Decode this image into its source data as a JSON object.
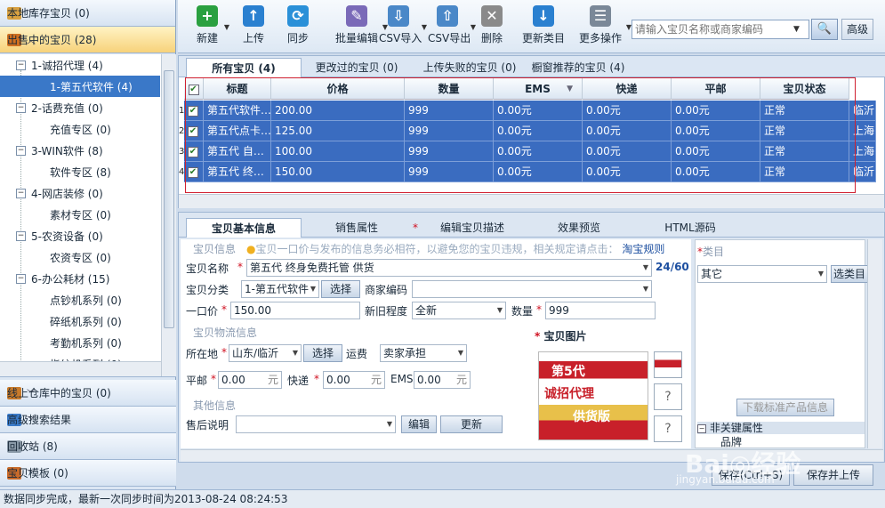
{
  "sidebar": {
    "top": {
      "label": "本地库存宝贝",
      "count": "(0)",
      "color": "#d8a040"
    },
    "selling": {
      "label": "出售中的宝贝",
      "count": "(28)",
      "color": "#d07020"
    },
    "tree": [
      {
        "kind": "parent",
        "text": "1-诚招代理 (4)"
      },
      {
        "kind": "child",
        "text": "1-第五代软件 (4)",
        "selected": true
      },
      {
        "kind": "parent",
        "text": "2-话费充值 (0)"
      },
      {
        "kind": "child",
        "text": "充值专区 (0)"
      },
      {
        "kind": "parent",
        "text": "3-WIN软件 (8)"
      },
      {
        "kind": "child",
        "text": "软件专区 (8)"
      },
      {
        "kind": "parent",
        "text": "4-网店装修 (0)"
      },
      {
        "kind": "child",
        "text": "素材专区 (0)"
      },
      {
        "kind": "parent",
        "text": "5-农资设备 (0)"
      },
      {
        "kind": "child",
        "text": "农资专区 (0)"
      },
      {
        "kind": "parent",
        "text": "6-办公耗材 (15)"
      },
      {
        "kind": "child",
        "text": "点钞机系列 (0)"
      },
      {
        "kind": "child",
        "text": "碎纸机系列 (0)"
      },
      {
        "kind": "child",
        "text": "考勤机系列 (0)"
      },
      {
        "kind": "child",
        "text": "指纹机系列 (0)"
      }
    ],
    "bottom": [
      {
        "label": "线上仓库中的宝贝",
        "count": "(0)",
        "color": "#c87a2a"
      },
      {
        "label": "高级搜索结果",
        "count": "",
        "color": "#3a7ac8"
      },
      {
        "label": "回收站",
        "count": "(8)",
        "color": "#8a9aa8"
      },
      {
        "label": "宝贝模板",
        "count": "(0)",
        "color": "#c86a2a"
      }
    ]
  },
  "toolbar": {
    "buttons": [
      {
        "label": "新建",
        "icon": "plus-icon",
        "glyph": "+",
        "color": "#2aa040",
        "dropdown": true
      },
      {
        "label": "上传",
        "icon": "upload-icon",
        "glyph": "↑",
        "color": "#2a80d0",
        "dropdown": false
      },
      {
        "label": "同步",
        "icon": "sync-icon",
        "glyph": "⟳",
        "color": "#2a90d8",
        "dropdown": false
      },
      {
        "label": "批量编辑",
        "icon": "batch-edit-icon",
        "glyph": "✎",
        "color": "#7a6ab8",
        "dropdown": true
      },
      {
        "label": "CSV导入",
        "icon": "csv-import-icon",
        "glyph": "⇩",
        "color": "#4a88c8",
        "dropdown": true
      },
      {
        "label": "CSV导出",
        "icon": "csv-export-icon",
        "glyph": "⇧",
        "color": "#4a88c8",
        "dropdown": true
      },
      {
        "label": "删除",
        "icon": "delete-icon",
        "glyph": "✕",
        "color": "#8a8a8a",
        "dropdown": false
      },
      {
        "label": "更新类目",
        "icon": "update-category-icon",
        "glyph": "↓",
        "color": "#2a80d0",
        "dropdown": false
      },
      {
        "label": "更多操作",
        "icon": "more-actions-icon",
        "glyph": "☰",
        "color": "#7a8898",
        "dropdown": true
      }
    ],
    "search_placeholder": "请输入宝贝名称或商家编码",
    "search_icon": "search-icon",
    "advanced_label": "高级"
  },
  "grid": {
    "tabs": [
      "所有宝贝 (4)",
      "更改过的宝贝 (0)",
      "上传失败的宝贝 (0)",
      "橱窗推荐的宝贝 (4)"
    ],
    "columns": [
      "标题",
      "价格",
      "数量",
      "EMS",
      "快递",
      "平邮",
      "宝贝状态"
    ],
    "rows": [
      {
        "n": "1",
        "title": "第五代软件…",
        "price": "200.00",
        "qty": "999",
        "ems": "0.00元",
        "express": "0.00元",
        "mail": "0.00元",
        "status": "正常",
        "loc": "临沂"
      },
      {
        "n": "2",
        "title": "第五代点卡…",
        "price": "125.00",
        "qty": "999",
        "ems": "0.00元",
        "express": "0.00元",
        "mail": "0.00元",
        "status": "正常",
        "loc": "上海"
      },
      {
        "n": "3",
        "title": "第五代 自…",
        "price": "100.00",
        "qty": "999",
        "ems": "0.00元",
        "express": "0.00元",
        "mail": "0.00元",
        "status": "正常",
        "loc": "上海"
      },
      {
        "n": "4",
        "title": "第五代 终…",
        "price": "150.00",
        "qty": "999",
        "ems": "0.00元",
        "express": "0.00元",
        "mail": "0.00元",
        "status": "正常",
        "loc": "临沂"
      }
    ]
  },
  "detail": {
    "tabs": [
      "宝贝基本信息",
      "销售属性",
      "*",
      "编辑宝贝描述",
      "效果预览",
      "HTML源码"
    ],
    "section_info": "宝贝信息",
    "tip": "宝贝一口价与发布的信息务必相符，以避免您的宝贝违规，相关规定请点击：",
    "tip_link": "淘宝规则",
    "name_label": "宝贝名称",
    "name_value": "第五代 终身免费托管 供货",
    "name_counter": "24/60",
    "category_label": "宝贝分类",
    "category_value": "1-第五代软件",
    "select_label": "选择",
    "merchant_code_label": "商家编码",
    "merchant_code_value": "",
    "price_label": "一口价",
    "price_value": "150.00",
    "condition_label": "新旧程度",
    "condition_value": "全新",
    "quantity_label": "数量",
    "quantity_value": "999",
    "section_logistics": "宝贝物流信息",
    "location_label": "所在地",
    "location_value": "山东/临沂",
    "shipping_label": "运费",
    "shipping_value": "卖家承担",
    "mail_label": "平邮",
    "mail_value": "0.00",
    "express_label": "快递",
    "express_value": "0.00",
    "ems_label": "EMS",
    "ems_value": "0.00",
    "unit": "元",
    "section_other": "其他信息",
    "aftersale_label": "售后说明",
    "aftersale_value": "",
    "edit_label": "编辑",
    "refresh_label": "更新",
    "image_section": "宝贝图片",
    "image_text_top": "第5代",
    "image_text_mid": "诚招代理",
    "image_text_bottom": "供货版",
    "category_panel_label": "类目",
    "category_panel_value": "其它",
    "choose_category_label": "选类目",
    "download_std_label": "下载标准产品信息",
    "non_key_label": "非关键属性",
    "brand_label": "品牌"
  },
  "actions": {
    "save_label": "保存(Ctrl+S)",
    "save_upload_label": "保存并上传"
  },
  "status": {
    "text": "数据同步完成，最新一次同步时间为2013-08-24 08:24:53"
  },
  "watermark": {
    "logo": "Bai◎经验",
    "url": "jingyan.baidu.com"
  }
}
